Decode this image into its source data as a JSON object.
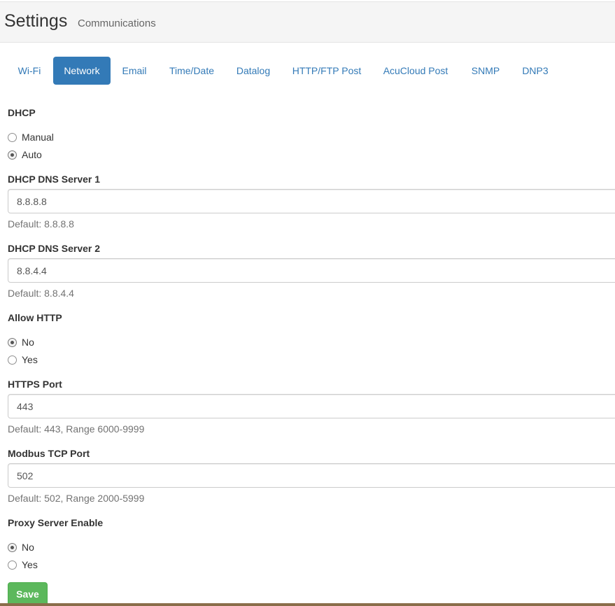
{
  "header": {
    "title": "Settings",
    "subtitle": "Communications"
  },
  "tabs": [
    {
      "label": "Wi-Fi",
      "active": false
    },
    {
      "label": "Network",
      "active": true
    },
    {
      "label": "Email",
      "active": false
    },
    {
      "label": "Time/Date",
      "active": false
    },
    {
      "label": "Datalog",
      "active": false
    },
    {
      "label": "HTTP/FTP Post",
      "active": false
    },
    {
      "label": "AcuCloud Post",
      "active": false
    },
    {
      "label": "SNMP",
      "active": false
    },
    {
      "label": "DNP3",
      "active": false
    }
  ],
  "dhcp": {
    "label": "DHCP",
    "options": [
      {
        "label": "Manual",
        "checked": false
      },
      {
        "label": "Auto",
        "checked": true
      }
    ]
  },
  "dns1": {
    "label": "DHCP DNS Server 1",
    "value": "8.8.8.8",
    "help": "Default: 8.8.8.8"
  },
  "dns2": {
    "label": "DHCP DNS Server 2",
    "value": "8.8.4.4",
    "help": "Default: 8.8.4.4"
  },
  "allow_http": {
    "label": "Allow HTTP",
    "options": [
      {
        "label": "No",
        "checked": true
      },
      {
        "label": "Yes",
        "checked": false
      }
    ]
  },
  "https_port": {
    "label": "HTTPS Port",
    "value": "443",
    "help": "Default: 443, Range 6000-9999"
  },
  "modbus_port": {
    "label": "Modbus TCP Port",
    "value": "502",
    "help": "Default: 502, Range 2000-5999"
  },
  "proxy": {
    "label": "Proxy Server Enable",
    "options": [
      {
        "label": "No",
        "checked": true
      },
      {
        "label": "Yes",
        "checked": false
      }
    ]
  },
  "save_label": "Save",
  "colors": {
    "primary": "#337ab7",
    "success": "#5cb85c",
    "header_bg": "#f5f5f5"
  }
}
